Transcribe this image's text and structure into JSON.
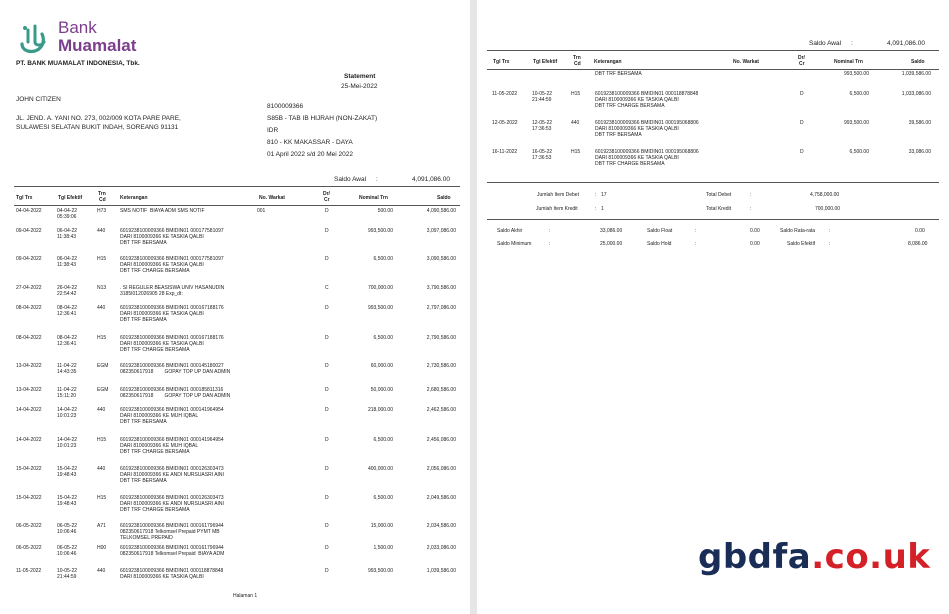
{
  "bank": {
    "logo_line1": "Bank",
    "logo_line2": "Muamalat",
    "company": "PT. BANK MUAMALAT INDONESIA, Tbk.",
    "brand_color": "#7b3f8c"
  },
  "statement": {
    "title": "Statement",
    "date": "25-Mei-2022"
  },
  "customer": {
    "name": "JOHN CITIZEN",
    "address_line1": "JL. JEND. A. YANI NO. 273, 002/009 KOTA PARE PARE,",
    "address_line2": "SULAWESI SELATAN BUKIT INDAH, SOREANG 91131"
  },
  "account": {
    "number": "8100009366",
    "product": "S85B - TAB IB HIJRAH (NON-ZAKAT)",
    "currency": "IDR",
    "branch": "810 - KK MAKASSAR - DAYA",
    "period": "01 April 2022 s/d 20 Mei 2022"
  },
  "saldo_awal": {
    "label": "Saldo Awal",
    "colon": ":",
    "value": "4,091,086.00"
  },
  "columns": {
    "tgl_trx": "Tgl Trx",
    "tgl_efektif": "Tgl Efektif",
    "trn_cd_1": "Trn",
    "trn_cd_2": "Cd",
    "keterangan": "Keterangan",
    "no_warkat": "No. Warkat",
    "dr_cr_1": "Dr/",
    "dr_cr_2": "Cr",
    "nominal": "Nominal Trn",
    "saldo": "Saldo"
  },
  "page1_rows": [
    {
      "tgl": "04-04-2022",
      "eff": "04-04-22\n05:39:06",
      "cd": "H73",
      "ket": "SMS NOTIF  BIAYA ADM SMS NOTIF",
      "warkat": "001",
      "drcr": "D",
      "nominal": "500.00",
      "saldo": "4,090,586.00"
    },
    {
      "tgl": "09-04-2022",
      "eff": "06-04-22\n11:38:43",
      "cd": "440",
      "ket": "6019238100009366 BMIDIN01 000177581097\nDARI 8100009366 KE TASKIA QALBI\nDBT TRF BERSAMA",
      "warkat": "",
      "drcr": "D",
      "nominal": "993,500.00",
      "saldo": "3,097,086.00"
    },
    {
      "tgl": "09-04-2022",
      "eff": "06-04-22\n11:38:43",
      "cd": "H15",
      "ket": "6019238100009366 BMIDIN01 000177581097\nDARI 8100009366 KE TASKIA QALBI\nDBT TRF CHARGE BERSAMA",
      "warkat": "",
      "drcr": "D",
      "nominal": "6,500.00",
      "saldo": "3,090,586.00"
    },
    {
      "tgl": "27-04-2022",
      "eff": "26-04-22\n22:54:42",
      "cd": "N13",
      "ket": ". SI REGULER BEASISWA UNIV HASANUDIN\n3185I012026905 28 Exp_dt:",
      "warkat": "",
      "drcr": "C",
      "nominal": "700,000.00",
      "saldo": "3,790,586.00"
    },
    {
      "tgl": "08-04-2022",
      "eff": "08-04-22\n12:36:41",
      "cd": "440",
      "ket": "6019238100009366 BMIDIN01 000167188176\nDARI 8100009366 KE TASKIA QALBI\nDBT TRF BERSAMA",
      "warkat": "",
      "drcr": "D",
      "nominal": "993,500.00",
      "saldo": "2,797,086.00"
    },
    {
      "tgl": "08-04-2022",
      "eff": "08-04-22\n12:36:41",
      "cd": "H15",
      "ket": "6019238100009366 BMIDIN01 000167188176\nDARI 8100009366 KE TASKIA QALBI\nDBT TRF CHARGE BERSAMA",
      "warkat": "",
      "drcr": "D",
      "nominal": "6,500.00",
      "saldo": "2,790,586.00"
    },
    {
      "tgl": "13-04-2022",
      "eff": "11-04-22\n14:43:35",
      "cd": "EGM",
      "ket": "6019238100009366 BMIDIN01 000145180027\n082350617918        GOPAY TOP UP DAN ADMIN",
      "warkat": "",
      "drcr": "D",
      "nominal": "60,000.00",
      "saldo": "2,730,586.00"
    },
    {
      "tgl": "13-04-2022",
      "eff": "11-04-22\n15:11:20",
      "cd": "EGM",
      "ket": "6019238100009366 BMIDIN01 000185811316\n082350617918        GOPAY TOP UP DAN ADMIN",
      "warkat": "",
      "drcr": "D",
      "nominal": "50,000.00",
      "saldo": "2,680,586.00"
    },
    {
      "tgl": "14-04-2022",
      "eff": "14-04-22\n10:01:23",
      "cd": "440",
      "ket": "6019238100009366 BMIDIN01 000141964954\nDARI 8100009366 KE MUH IQBAL\nDBT TRF BERSAMA",
      "warkat": "",
      "drcr": "D",
      "nominal": "218,000.00",
      "saldo": "2,462,586.00"
    },
    {
      "tgl": "14-04-2022",
      "eff": "14-04-22\n10:01:23",
      "cd": "H15",
      "ket": "6019238100009366 BMIDIN01 000141964954\nDARI 8100009366 KE MUH IQBAL\nDBT TRF CHARGE BERSAMA",
      "warkat": "",
      "drcr": "D",
      "nominal": "6,500.00",
      "saldo": "2,456,086.00"
    },
    {
      "tgl": "15-04-2022",
      "eff": "15-04-22\n19:48:43",
      "cd": "440",
      "ket": "6019238100009366 BMIDIN01 000126303473\nDARI 8100009366 KE ANDI NURSUASRI AINI\nDBT TRF BERSAMA",
      "warkat": "",
      "drcr": "D",
      "nominal": "400,000.00",
      "saldo": "2,056,086.00"
    },
    {
      "tgl": "15-04-2022",
      "eff": "15-04-22\n19:48:43",
      "cd": "H15",
      "ket": "6019238100009366 BMIDIN01 000126303473\nDARI 8100009366 KE ANDI NURSUASRI AINI\nDBT TRF CHARGE BERSAMA",
      "warkat": "",
      "drcr": "D",
      "nominal": "6,500.00",
      "saldo": "2,049,586.00"
    },
    {
      "tgl": "06-05-2022",
      "eff": "06-05-22\n10:06:46",
      "cd": "A71",
      "ket": "6019238100009366 BMIDIN01 000161796944\n082350617918 Telkomsel Prepaid PYMT MB\nTELKOMSEL PREPAID",
      "warkat": "",
      "drcr": "D",
      "nominal": "15,000.00",
      "saldo": "2,034,586.00"
    },
    {
      "tgl": "06-05-2022",
      "eff": "06-05-22\n10:06:46",
      "cd": "H00",
      "ket": "6019238100009366 BMIDIN01 000161796944\n082350617918 Telkomsel Prepaid  BIAYA ADM",
      "warkat": "",
      "drcr": "D",
      "nominal": "1,500.00",
      "saldo": "2,033,086.00"
    },
    {
      "tgl": "11-05-2022",
      "eff": "10-05-22\n21:44:59",
      "cd": "440",
      "ket": "6019238100009366 BMIDIN01 000118878848\nDARI 8100009366 KE TASKIA QALBI",
      "warkat": "",
      "drcr": "D",
      "nominal": "993,500.00",
      "saldo": "1,039,586.00"
    }
  ],
  "page1_footer": "Halaman 1",
  "page2_rows": [
    {
      "tgl": "",
      "eff": "",
      "cd": "",
      "ket": "DBT TRF BERSAMA",
      "warkat": "",
      "drcr": "",
      "nominal": "",
      "saldo": ""
    },
    {
      "tgl": "11-05-2022",
      "eff": "10-05-22\n21:44:59",
      "cd": "H15",
      "ket": "6019238100009366 BMIDIN01 000118878848\nDARI 8100009366 KE TASKIA QALBI\nDBT TRF CHARGE BERSAMA",
      "warkat": "",
      "drcr": "D",
      "nominal": "6,500.00",
      "saldo": "1,033,086.00"
    },
    {
      "tgl": "12-05-2022",
      "eff": "12-05-22\n17:36:53",
      "cd": "440",
      "ket": "6019238100009366 BMIDIN01 000195068806\nDARI 8100009366 KE TASKIA QALBI\nDBT TRF BERSAMA",
      "warkat": "",
      "drcr": "D",
      "nominal": "993,500.00",
      "saldo": "39,586.00"
    },
    {
      "tgl": "16-11-2022",
      "eff": "16-05-22\n17:36:53",
      "cd": "H15",
      "ket": "6019238100009366 BMIDIN01 000195068806\nDARI 8100009366 KE TASKIA QALBI\nDBT TRF CHARGE BERSAMA",
      "warkat": "",
      "drcr": "D",
      "nominal": "6,500.00",
      "saldo": "33,086.00"
    }
  ],
  "page2_partial": {
    "nominal": "993,500.00",
    "saldo": "1,039,586.00"
  },
  "summary": {
    "jumlah_debet_label": "Jumlah Item Debet",
    "jumlah_debet": "17",
    "jumlah_kredit_label": "Jumlah Item Kredit",
    "jumlah_kredit": "1",
    "total_debet_label": "Total Debet",
    "total_debet": "4,758,000.00",
    "total_kredit_label": "Total Kredit",
    "total_kredit": "700,000.00",
    "colon": ":"
  },
  "balances": {
    "saldo_akhir_label": "Saldo Akhir",
    "saldo_akhir": "33,086.00",
    "saldo_float_label": "Saldo Float",
    "saldo_float": "0.00",
    "saldo_rata_label": "Saldo Rata-rata",
    "saldo_rata": "0.00",
    "saldo_minimum_label": "Saldo Minimum",
    "saldo_minimum": "25,000.00",
    "saldo_hold_label": "Saldo Hold",
    "saldo_hold": "0.00",
    "saldo_efektif_label": "Saldo Efektif",
    "saldo_efektif": "8,086.00",
    "colon": ":"
  },
  "watermark": {
    "main": "gbdfa",
    "tld": ".co.uk",
    "main_color": "#1a2d56",
    "tld_color": "#d42027"
  }
}
